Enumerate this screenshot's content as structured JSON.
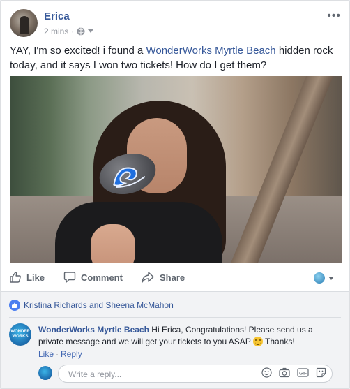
{
  "post": {
    "author": "Erica",
    "time": "2 mins",
    "separator": "·",
    "more_label": "•••",
    "text_before": "YAY, I'm so excited! i found a ",
    "link_text": "WonderWorks Myrtle Beach",
    "text_after": " hidden rock today, and it says I won two tickets! How do I get them?"
  },
  "actions": {
    "like": "Like",
    "comment": "Comment",
    "share": "Share"
  },
  "reactions": {
    "names": "Kristina Richards and Sheena McMahon"
  },
  "comment": {
    "author": "WonderWorks Myrtle Beach",
    "text": " Hi Erica, Congratulations! Please send us a private message and we will get your tickets to you ASAP ",
    "text_end": " Thanks!",
    "avatar_text": "WONDER WORKS",
    "like_link": "Like",
    "dot": "·",
    "reply_link": "Reply"
  },
  "reply": {
    "placeholder": "Write a reply..."
  },
  "icons": {
    "privacy": "globe-icon",
    "like": "thumbs-up-icon",
    "comment": "speech-bubble-icon",
    "share": "share-arrow-icon",
    "emoji": "emoji-icon",
    "camera": "camera-icon",
    "gif": "gif-icon",
    "sticker": "sticker-icon"
  },
  "colors": {
    "link": "#365899",
    "accent": "#4267b2",
    "muted": "#90949c"
  }
}
